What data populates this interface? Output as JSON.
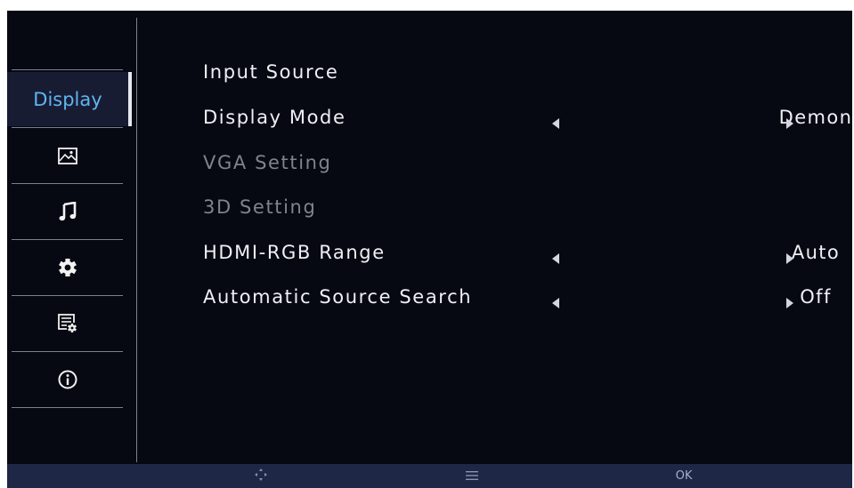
{
  "sidebar": {
    "active_label": "Display",
    "items": [
      {
        "name": "Display",
        "icon": "display-tab"
      },
      {
        "name": "picture",
        "icon": "picture-icon"
      },
      {
        "name": "sound",
        "icon": "music-note-icon"
      },
      {
        "name": "settings",
        "icon": "gear-icon"
      },
      {
        "name": "advanced",
        "icon": "settings-list-icon"
      },
      {
        "name": "about",
        "icon": "info-icon"
      }
    ]
  },
  "menu": {
    "rows": [
      {
        "label": "Input Source",
        "type": "submenu",
        "chevron": ">",
        "enabled": true
      },
      {
        "label": "Display Mode",
        "type": "selector",
        "value": "Demon",
        "enabled": true
      },
      {
        "label": "VGA Setting",
        "type": "submenu",
        "chevron": ">",
        "enabled": false
      },
      {
        "label": "3D Setting",
        "type": "submenu",
        "chevron": ">",
        "enabled": false
      },
      {
        "label": "HDMI-RGB Range",
        "type": "selector",
        "value": "Auto",
        "enabled": true
      },
      {
        "label": "Automatic Source Search",
        "type": "selector",
        "value": "Off",
        "enabled": true
      }
    ]
  },
  "bottom_bar": {
    "hints": [
      {
        "icon": "dpad-icon",
        "label": ""
      },
      {
        "icon": "menu-lines-icon",
        "label": ""
      },
      {
        "icon": "",
        "label": "OK"
      }
    ]
  },
  "colors": {
    "background": "#060812",
    "active_tab_text": "#5fb5f0",
    "active_tab_bg": "#181c33",
    "bottom_bar": "#1e2745",
    "disabled_text": "#80838d"
  }
}
